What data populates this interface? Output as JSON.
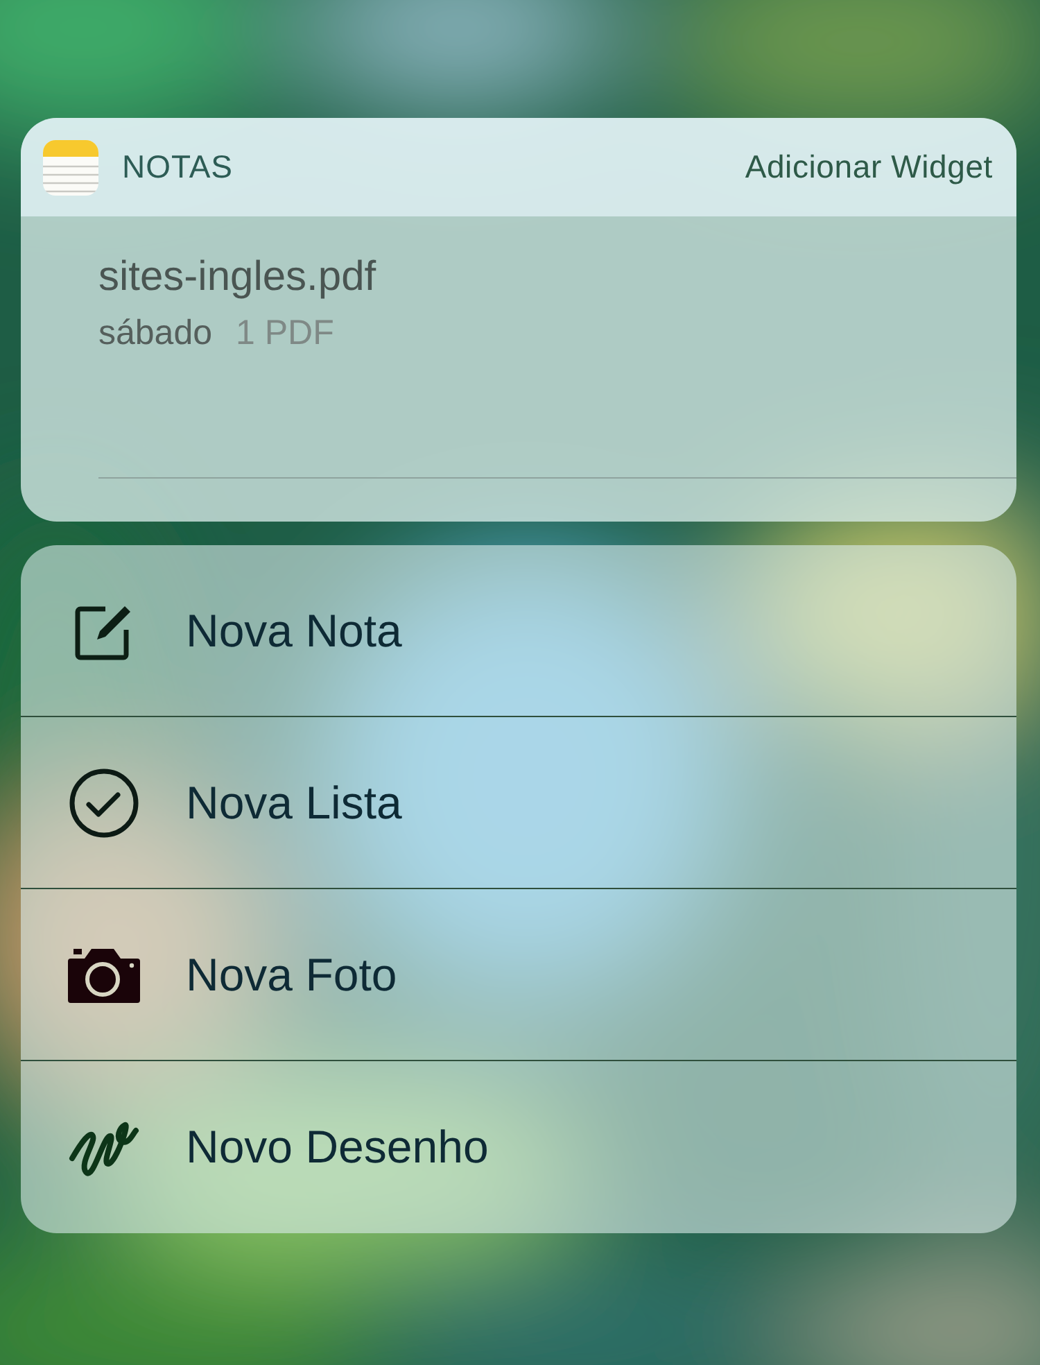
{
  "widget": {
    "app_name": "NOTAS",
    "add_button": "Adicionar Widget",
    "note": {
      "title": "sites-ingles.pdf",
      "date": "sábado",
      "attachment": "1 PDF"
    }
  },
  "actions": [
    {
      "kind": "compose",
      "label": "Nova Nota"
    },
    {
      "kind": "checklist",
      "label": "Nova Lista"
    },
    {
      "kind": "camera",
      "label": "Nova Foto"
    },
    {
      "kind": "sketch",
      "label": "Novo Desenho"
    }
  ]
}
